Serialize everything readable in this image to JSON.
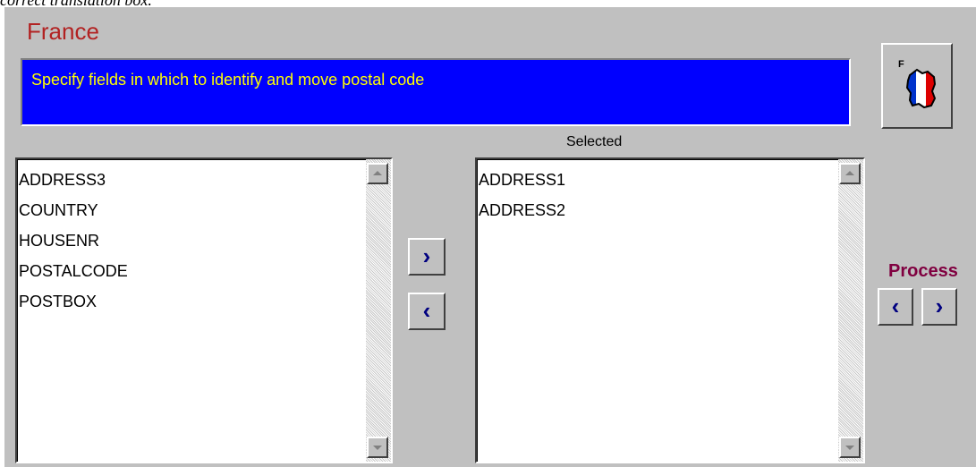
{
  "caption": "correct translation box.",
  "header": {
    "country": "France"
  },
  "banner": {
    "text": "Specify fields in which to identify and move postal code"
  },
  "flag_button": {
    "letter": "F",
    "icon": "france-map-flag-icon",
    "colors": {
      "blue": "#0033cc",
      "white": "#ffffff",
      "red": "#dd0000"
    }
  },
  "available_list": {
    "items": [
      "ADDRESS3",
      "COUNTRY",
      "HOUSENR",
      "POSTALCODE",
      "POSTBOX"
    ]
  },
  "selected_list": {
    "label": "Selected",
    "items": [
      "ADDRESS1",
      "ADDRESS2"
    ]
  },
  "move_buttons": {
    "add": "›",
    "remove": "‹"
  },
  "process": {
    "label": "Process",
    "prev": "‹",
    "next": "›"
  },
  "colors": {
    "panel": "#c0c0c0",
    "banner": "#0000ff",
    "banner_text": "#ffff00",
    "title": "#b22222",
    "process_label": "#800040",
    "arrow": "#000080"
  }
}
